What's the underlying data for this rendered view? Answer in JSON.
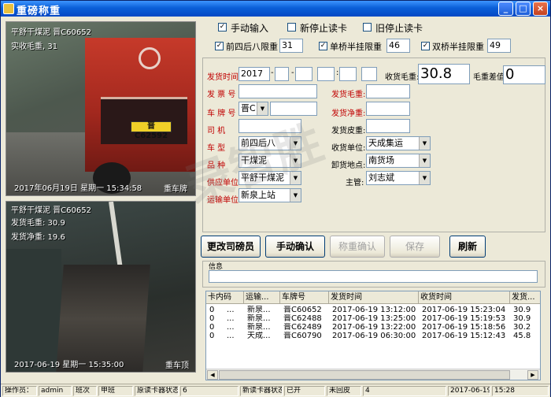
{
  "window": {
    "title": "重磅称重"
  },
  "camera1": {
    "line1": "平舒干煤泥  晋C60652",
    "line2": "实收毛重, 31",
    "timestamp": "2017年06月19日  星期一  15:34:58",
    "label": "重车牌",
    "plate": "晋C62592"
  },
  "camera2": {
    "line1": "平舒干煤泥  晋C60652",
    "line2": "发货毛重: 30.9",
    "line3": "发货净重: 19.6",
    "timestamp": "2017-06-19  星期一  15:35:00",
    "label": "重车顶"
  },
  "options": {
    "manual_input": {
      "label": "手动输入",
      "checked": "✓"
    },
    "new_stop_card": {
      "label": "新停止读卡"
    },
    "old_stop_card": {
      "label": "旧停止读卡"
    },
    "front4rear8": {
      "label": "前四后八限重",
      "checked": "✓",
      "value": "31"
    },
    "single_semi": {
      "label": "单桥半挂限重",
      "checked": "✓",
      "value": "46"
    },
    "double_semi": {
      "label": "双桥半挂限重",
      "checked": "✓",
      "value": "49"
    }
  },
  "form": {
    "ship_time_label": "发货时间",
    "ship_time_year": "2017",
    "date_sep": "-",
    "time_sep": ":",
    "receive_gross_label": "收货毛重:",
    "receive_gross_value": "30.8",
    "gross_diff_label": "毛重差值:",
    "gross_diff_value": "0",
    "ticket_label": "发 票 号",
    "ship_gross_label": "发货毛重:",
    "plate_label": "车 牌 号",
    "plate_prefix": "晋C",
    "ship_net_label": "发货净重:",
    "driver_label": "司    机",
    "ship_tare_label": "发货皮重:",
    "vehicle_type_label": "车    型",
    "vehicle_type_value": "前四后八",
    "receive_unit_label": "收货单位:",
    "receive_unit_value": "天成集运",
    "variety_label": "品    种",
    "variety_value": "干煤泥",
    "unload_label": "卸货地点:",
    "unload_value": "南货场",
    "supplier_label": "供应单位",
    "supplier_value": "平舒干煤泥",
    "manager_label": "主管:",
    "manager_value": "刘志斌",
    "transport_label": "运输单位",
    "transport_value": "新泉上站"
  },
  "buttons": {
    "change_driver": "更改司磅员",
    "manual_confirm": "手动确认",
    "weigh_confirm": "称重确认",
    "save": "保存",
    "refresh": "刷新"
  },
  "info": {
    "label": "信息"
  },
  "table": {
    "headers": [
      "卡内码",
      "运输...",
      "车牌号",
      "发货时间",
      "收货时间",
      "发货..."
    ],
    "rows": [
      [
        "0",
        "...",
        "新泉...",
        "晋C60652",
        "2017-06-19 13:12:00",
        "2017-06-19 15:23:04",
        "30.9"
      ],
      [
        "0",
        "...",
        "新泉...",
        "晋C62488",
        "2017-06-19 13:25:00",
        "2017-06-19 15:19:53",
        "30.9"
      ],
      [
        "0",
        "...",
        "新泉...",
        "晋C62489",
        "2017-06-19 13:22:00",
        "2017-06-19 15:18:56",
        "30.2"
      ],
      [
        "0",
        "...",
        "天成...",
        "晋C60790",
        "2017-06-19 06:30:00",
        "2017-06-19 15:12:43",
        "45.8"
      ]
    ]
  },
  "status": {
    "operator_label": "操作员：",
    "operator_value": "admin",
    "shift_label": "班次",
    "shift_value": "甲班",
    "orig_reader_label": "原读卡器状态",
    "orig_reader_value": "6",
    "new_reader_label": "新读卡器状态",
    "new_reader_value": "已开",
    "scale_label": "未回皮",
    "scale_value": "4",
    "date": "2017-06-19",
    "time": "15:28"
  },
  "watermark": "录智胜"
}
